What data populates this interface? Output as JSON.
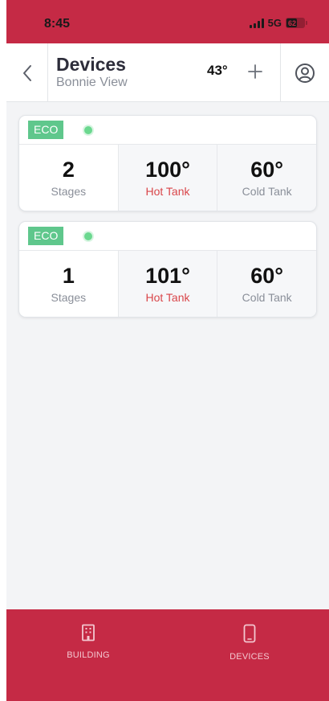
{
  "status_bar": {
    "time": "8:45",
    "network": "5G",
    "battery": "62"
  },
  "header": {
    "title": "Devices",
    "subtitle": "Bonnie View",
    "temperature": "43°"
  },
  "devices": [
    {
      "mode": "ECO",
      "status_color": "#6bd88f",
      "stages": {
        "value": "2",
        "label": "Stages"
      },
      "hot_tank": {
        "value": "100°",
        "label": "Hot Tank"
      },
      "cold_tank": {
        "value": "60°",
        "label": "Cold Tank"
      }
    },
    {
      "mode": "ECO",
      "status_color": "#6bd88f",
      "stages": {
        "value": "1",
        "label": "Stages"
      },
      "hot_tank": {
        "value": "101°",
        "label": "Hot Tank"
      },
      "cold_tank": {
        "value": "60°",
        "label": "Cold Tank"
      }
    }
  ],
  "bottom_nav": {
    "items": [
      {
        "label": "BUILDING",
        "icon": "building-icon"
      },
      {
        "label": "DEVICES",
        "icon": "phone-icon"
      }
    ]
  },
  "colors": {
    "brand": "#c52a45",
    "eco_badge": "#5fc78c",
    "hot_label": "#d9464a"
  }
}
